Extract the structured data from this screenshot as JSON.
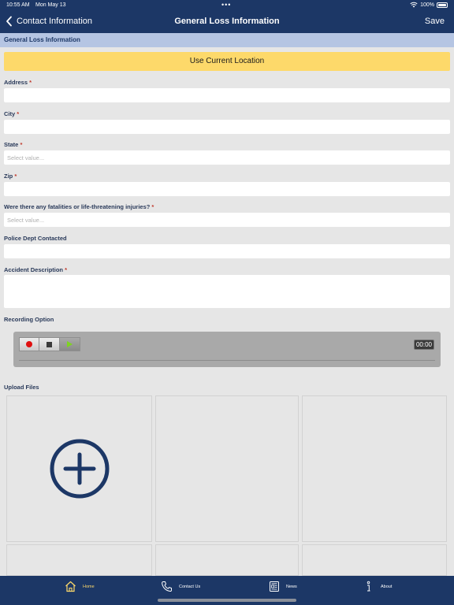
{
  "status_bar": {
    "time": "10:55 AM",
    "date": "Mon May 13",
    "dots": "•••",
    "battery": "100%"
  },
  "nav": {
    "back_label": "Contact Information",
    "title": "General Loss Information",
    "save_label": "Save"
  },
  "section": {
    "title": "General Loss Information"
  },
  "location_button": {
    "label": "Use Current Location"
  },
  "form": {
    "required_mark": "*",
    "address": {
      "label": "Address",
      "value": ""
    },
    "city": {
      "label": "City",
      "value": ""
    },
    "state": {
      "label": "State",
      "placeholder": "Select value..."
    },
    "zip": {
      "label": "Zip",
      "value": ""
    },
    "fatalities": {
      "label": "Were there any fatalities or life-threatening injuries?",
      "placeholder": "Select value..."
    },
    "police": {
      "label": "Police Dept Contacted",
      "value": ""
    },
    "description": {
      "label": "Accident Description",
      "value": ""
    }
  },
  "recording": {
    "label": "Recording Option",
    "time": "00:00"
  },
  "upload": {
    "label": "Upload Files"
  },
  "tabs": [
    {
      "label": "Home",
      "icon": "home-icon",
      "active": true
    },
    {
      "label": "Contact Us",
      "icon": "phone-icon",
      "active": false
    },
    {
      "label": "News",
      "icon": "news-icon",
      "active": false
    },
    {
      "label": "About",
      "icon": "info-icon",
      "active": false
    }
  ],
  "colors": {
    "header_bg": "#1c3766",
    "section_bg": "#b5c5e3",
    "location_button_bg": "#fdd96a",
    "active_tab": "#fdd96a",
    "required": "#c0392b"
  }
}
